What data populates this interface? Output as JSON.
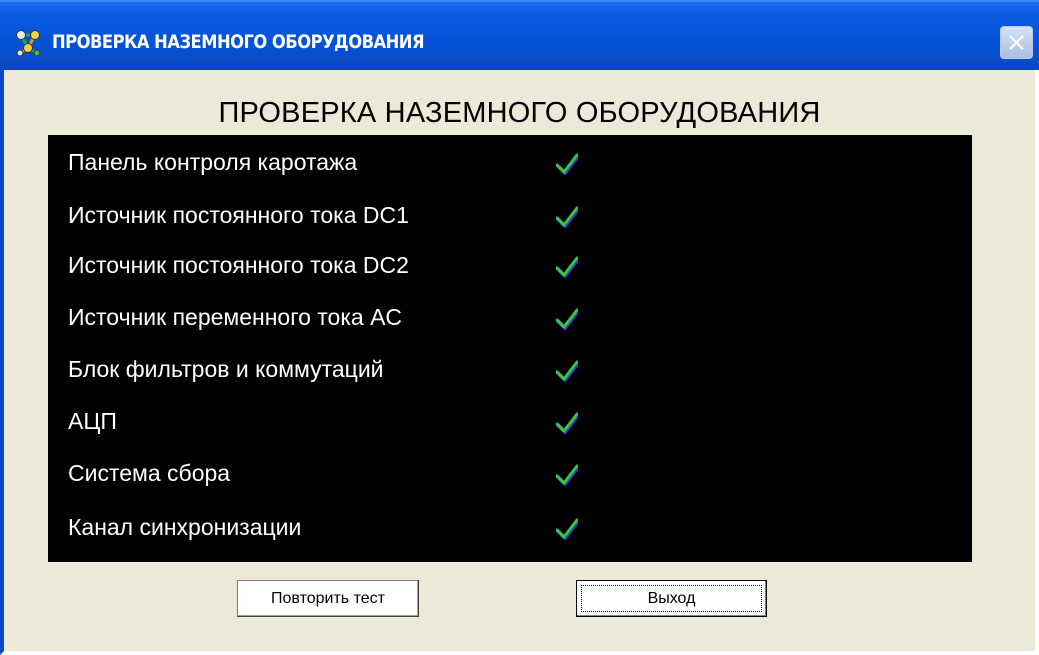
{
  "window": {
    "title": "ПРОВЕРКА НАЗЕМНОГО ОБОРУДОВАНИЯ",
    "app_icon": "network-app-icon",
    "close_icon": "close-icon"
  },
  "main": {
    "heading": "ПРОВЕРКА НАЗЕМНОГО ОБОРУДОВАНИЯ",
    "checks": [
      {
        "label": "Панель контроля каротажа",
        "status": "ok",
        "status_icon": "checkmark-icon"
      },
      {
        "label": "Источник постоянного тока DC1",
        "status": "ok",
        "status_icon": "checkmark-icon"
      },
      {
        "label": "Источник постоянного тока DC2",
        "status": "ok",
        "status_icon": "checkmark-icon"
      },
      {
        "label": "Источник переменного тока AC",
        "status": "ok",
        "status_icon": "checkmark-icon"
      },
      {
        "label": "Блок фильтров и коммутаций",
        "status": "ok",
        "status_icon": "checkmark-icon"
      },
      {
        "label": "АЦП",
        "status": "ok",
        "status_icon": "checkmark-icon"
      },
      {
        "label": "Система сбора",
        "status": "ok",
        "status_icon": "checkmark-icon"
      },
      {
        "label": "Канал синхронизации",
        "status": "ok",
        "status_icon": "checkmark-icon"
      }
    ]
  },
  "buttons": {
    "repeat_label": "Повторить тест",
    "exit_label": "Выход"
  },
  "colors": {
    "titlebar": "#0554d8",
    "window_bg": "#ece9d8",
    "panel_bg": "#000000",
    "panel_text": "#ffffff",
    "check_green": "#3cc23c",
    "check_blue": "#2a3fc8"
  }
}
